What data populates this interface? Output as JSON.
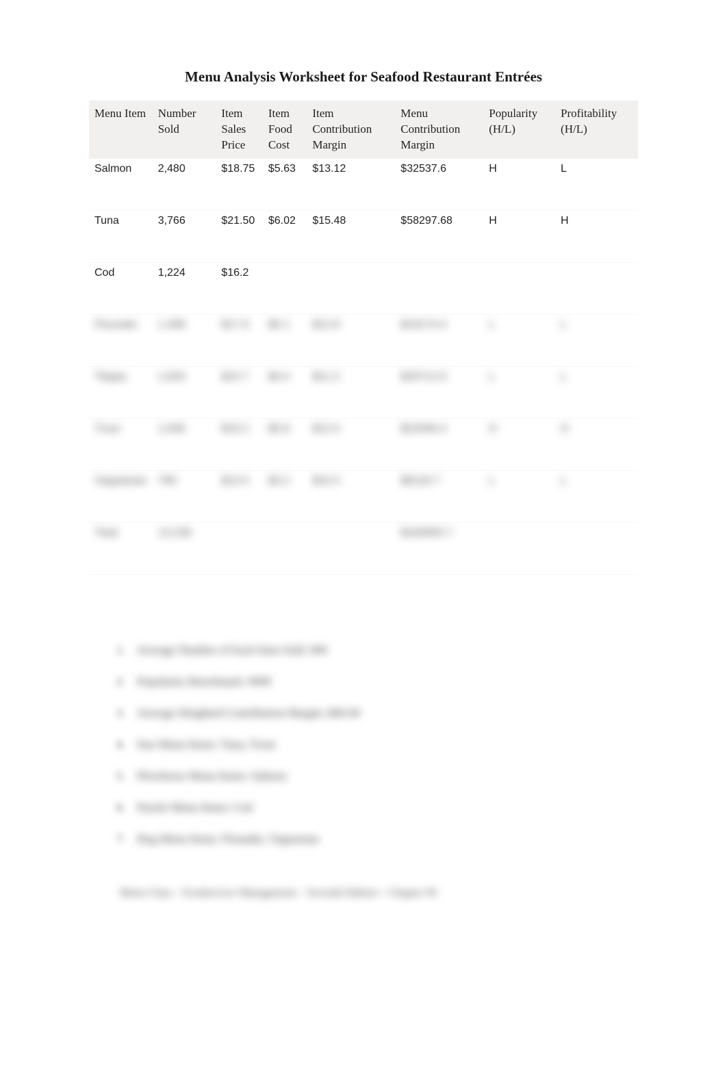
{
  "title": "Menu Analysis Worksheet for Seafood Restaurant Entrées",
  "table": {
    "headers": [
      "Menu Item",
      "Number Sold",
      "Item Sales Price",
      "Item Food Cost",
      "Item Contribution Margin",
      "Menu Contribution Margin",
      "Popularity (H/L)",
      "Profitability (H/L)"
    ],
    "rows": [
      {
        "item": "Salmon",
        "sold": "2,480",
        "price": "$18.75",
        "cost": "$5.63",
        "icm": "$13.12",
        "mcm": "$32537.6",
        "pop": "H",
        "prof": "L"
      },
      {
        "item": "Tuna",
        "sold": "3,766",
        "price": "$21.50",
        "cost": "$6.02",
        "icm": "$15.48",
        "mcm": "$58297.68",
        "pop": "H",
        "prof": "H"
      },
      {
        "item": "Cod",
        "sold": "1,224",
        "price": "$16.2",
        "cost": "",
        "icm": "",
        "mcm": "",
        "pop": "",
        "prof": ""
      }
    ],
    "blurred_rows": [
      {
        "item": "Flounder",
        "sold": "1,498",
        "price": "$17.9",
        "cost": "$5.1",
        "icm": "$12.8",
        "mcm": "$19174.4",
        "pop": "L",
        "prof": "L"
      },
      {
        "item": "Tilapia",
        "sold": "1,833",
        "price": "$15.7",
        "cost": "$4.4",
        "icm": "$11.3",
        "mcm": "$20712.9",
        "pop": "L",
        "prof": "L"
      },
      {
        "item": "Trout",
        "sold": "1,646",
        "price": "$19.2",
        "cost": "$5.8",
        "icm": "$13.4",
        "mcm": "$22056.4",
        "pop": "H",
        "prof": "H"
      },
      {
        "item": "Vegetarian",
        "sold": "789",
        "price": "$13.5",
        "cost": "$3.2",
        "icm": "$10.3",
        "mcm": "$8126.7",
        "pop": "L",
        "prof": "L"
      },
      {
        "item": "Total",
        "sold": "13,236",
        "price": "",
        "cost": "",
        "icm": "",
        "mcm": "$160905.7",
        "pop": "",
        "prof": ""
      }
    ]
  },
  "blur_list": [
    "Average Number of Each Item Sold: ###",
    "Popularity Benchmark: ####",
    "Average Weighted Contribution Margin: $##.##",
    "Star Menu Items: Tuna, Trout",
    "Plowhorse Menu Items: Salmon",
    "Puzzle Menu Items: Cod",
    "Dog Menu Items: Flounder, Vegetarian"
  ],
  "blur_footer": "Menu Class – Foodservice Management – Seventh Edition – Chapter ##"
}
